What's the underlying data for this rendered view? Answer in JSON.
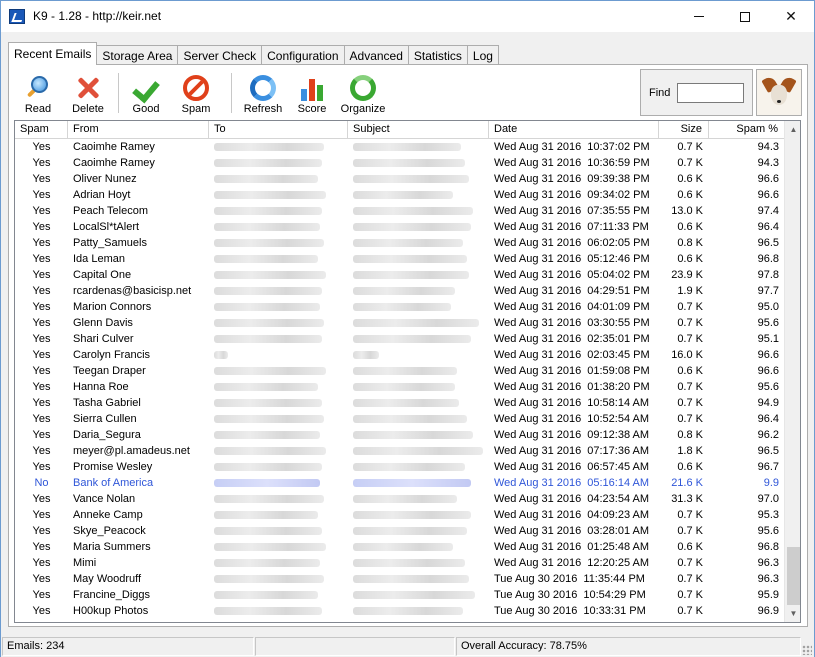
{
  "window": {
    "title": "K9 - 1.28 - http://keir.net",
    "controls": [
      "minimize",
      "maximize",
      "close"
    ]
  },
  "tabs": [
    {
      "label": "Recent Emails",
      "active": true
    },
    {
      "label": "Storage Area",
      "active": false
    },
    {
      "label": "Server Check",
      "active": false
    },
    {
      "label": "Configuration",
      "active": false
    },
    {
      "label": "Advanced",
      "active": false
    },
    {
      "label": "Statistics",
      "active": false
    },
    {
      "label": "Log",
      "active": false
    }
  ],
  "toolbar": {
    "read": {
      "label": "Read",
      "icon": "magnifier-icon"
    },
    "delete": {
      "label": "Delete",
      "icon": "red-x-icon"
    },
    "good": {
      "label": "Good",
      "icon": "green-check-icon"
    },
    "spam": {
      "label": "Spam",
      "icon": "no-entry-icon"
    },
    "refresh": {
      "label": "Refresh",
      "icon": "refresh-arrows-icon"
    },
    "score": {
      "label": "Score",
      "icon": "bar-chart-icon"
    },
    "organize": {
      "label": "Organize",
      "icon": "green-cycle-icon"
    }
  },
  "find": {
    "label": "Find",
    "value": ""
  },
  "table": {
    "columns": [
      "Spam",
      "From",
      "To",
      "Subject",
      "Date",
      "Size",
      "Spam %"
    ],
    "rows": [
      {
        "spam": "Yes",
        "from": "Caoimhe Ramey",
        "date": "Wed Aug 31 2016",
        "time": "10:37:02 PM",
        "size": "0.7 K",
        "pct": "94.3"
      },
      {
        "spam": "Yes",
        "from": "Caoimhe Ramey",
        "date": "Wed Aug 31 2016",
        "time": "10:36:59 PM",
        "size": "0.7 K",
        "pct": "94.3"
      },
      {
        "spam": "Yes",
        "from": "Oliver Nunez",
        "date": "Wed Aug 31 2016",
        "time": "09:39:38 PM",
        "size": "0.6 K",
        "pct": "96.6"
      },
      {
        "spam": "Yes",
        "from": "Adrian Hoyt",
        "date": "Wed Aug 31 2016",
        "time": "09:34:02 PM",
        "size": "0.6 K",
        "pct": "96.6"
      },
      {
        "spam": "Yes",
        "from": "Peach Telecom",
        "date": "Wed Aug 31 2016",
        "time": "07:35:55 PM",
        "size": "13.0 K",
        "pct": "97.4"
      },
      {
        "spam": "Yes",
        "from": "LocalSl*tAlert",
        "date": "Wed Aug 31 2016",
        "time": "07:11:33 PM",
        "size": "0.6 K",
        "pct": "96.4"
      },
      {
        "spam": "Yes",
        "from": "Patty_Samuels",
        "date": "Wed Aug 31 2016",
        "time": "06:02:05 PM",
        "size": "0.8 K",
        "pct": "96.5"
      },
      {
        "spam": "Yes",
        "from": "Ida Leman",
        "date": "Wed Aug 31 2016",
        "time": "05:12:46 PM",
        "size": "0.6 K",
        "pct": "96.8"
      },
      {
        "spam": "Yes",
        "from": "Capital One",
        "date": "Wed Aug 31 2016",
        "time": "05:04:02 PM",
        "size": "23.9 K",
        "pct": "97.8"
      },
      {
        "spam": "Yes",
        "from": "rcardenas@basicisp.net",
        "date": "Wed Aug 31 2016",
        "time": "04:29:51 PM",
        "size": "1.9 K",
        "pct": "97.7"
      },
      {
        "spam": "Yes",
        "from": "Marion Connors",
        "date": "Wed Aug 31 2016",
        "time": "04:01:09 PM",
        "size": "0.7 K",
        "pct": "95.0"
      },
      {
        "spam": "Yes",
        "from": "Glenn Davis",
        "date": "Wed Aug 31 2016",
        "time": "03:30:55 PM",
        "size": "0.7 K",
        "pct": "95.6"
      },
      {
        "spam": "Yes",
        "from": "Shari Culver",
        "date": "Wed Aug 31 2016",
        "time": "02:35:01 PM",
        "size": "0.7 K",
        "pct": "95.1"
      },
      {
        "spam": "Yes",
        "from": "Carolyn Francis",
        "date": "Wed Aug 31 2016",
        "time": "02:03:45 PM",
        "size": "16.0 K",
        "pct": "96.6"
      },
      {
        "spam": "Yes",
        "from": "Teegan Draper",
        "date": "Wed Aug 31 2016",
        "time": "01:59:08 PM",
        "size": "0.6 K",
        "pct": "96.6"
      },
      {
        "spam": "Yes",
        "from": "Hanna Roe",
        "date": "Wed Aug 31 2016",
        "time": "01:38:20 PM",
        "size": "0.7 K",
        "pct": "95.6"
      },
      {
        "spam": "Yes",
        "from": "Tasha Gabriel",
        "date": "Wed Aug 31 2016",
        "time": "10:58:14 AM",
        "size": "0.7 K",
        "pct": "94.9"
      },
      {
        "spam": "Yes",
        "from": "Sierra Cullen",
        "date": "Wed Aug 31 2016",
        "time": "10:52:54 AM",
        "size": "0.7 K",
        "pct": "96.4"
      },
      {
        "spam": "Yes",
        "from": "Daria_Segura",
        "date": "Wed Aug 31 2016",
        "time": "09:12:38 AM",
        "size": "0.8 K",
        "pct": "96.2"
      },
      {
        "spam": "Yes",
        "from": "meyer@pl.amadeus.net",
        "date": "Wed Aug 31 2016",
        "time": "07:17:36 AM",
        "size": "1.8 K",
        "pct": "96.5"
      },
      {
        "spam": "Yes",
        "from": "Promise Wesley",
        "date": "Wed Aug 31 2016",
        "time": "06:57:45 AM",
        "size": "0.6 K",
        "pct": "96.7"
      },
      {
        "spam": "No",
        "from": "Bank of America",
        "date": "Wed Aug 31 2016",
        "time": "05:16:14 AM",
        "size": "21.6 K",
        "pct": "9.9"
      },
      {
        "spam": "Yes",
        "from": "Vance Nolan",
        "date": "Wed Aug 31 2016",
        "time": "04:23:54 AM",
        "size": "31.3 K",
        "pct": "97.0"
      },
      {
        "spam": "Yes",
        "from": "Anneke Camp",
        "date": "Wed Aug 31 2016",
        "time": "04:09:23 AM",
        "size": "0.7 K",
        "pct": "95.3"
      },
      {
        "spam": "Yes",
        "from": "Skye_Peacock",
        "date": "Wed Aug 31 2016",
        "time": "03:28:01 AM",
        "size": "0.7 K",
        "pct": "95.6"
      },
      {
        "spam": "Yes",
        "from": "Maria Summers",
        "date": "Wed Aug 31 2016",
        "time": "01:25:48 AM",
        "size": "0.6 K",
        "pct": "96.8"
      },
      {
        "spam": "Yes",
        "from": "Mimi",
        "date": "Wed Aug 31 2016",
        "time": "12:20:25 AM",
        "size": "0.7 K",
        "pct": "96.3"
      },
      {
        "spam": "Yes",
        "from": "May Woodruff",
        "date": "Tue Aug 30 2016",
        "time": "11:35:44 PM",
        "size": "0.7 K",
        "pct": "96.3"
      },
      {
        "spam": "Yes",
        "from": "Francine_Diggs",
        "date": "Tue Aug 30 2016",
        "time": "10:54:29 PM",
        "size": "0.7 K",
        "pct": "95.9"
      },
      {
        "spam": "Yes",
        "from": "H00kup Photos",
        "date": "Tue Aug 30 2016",
        "time": "10:33:31 PM",
        "size": "0.7 K",
        "pct": "96.9"
      }
    ]
  },
  "status": {
    "emails": "Emails: 234",
    "middle": "",
    "accuracy": "Overall Accuracy: 78.75%"
  },
  "colors": {
    "no_spam_row": "#2f56d8",
    "window_border": "#6c9bd0"
  }
}
